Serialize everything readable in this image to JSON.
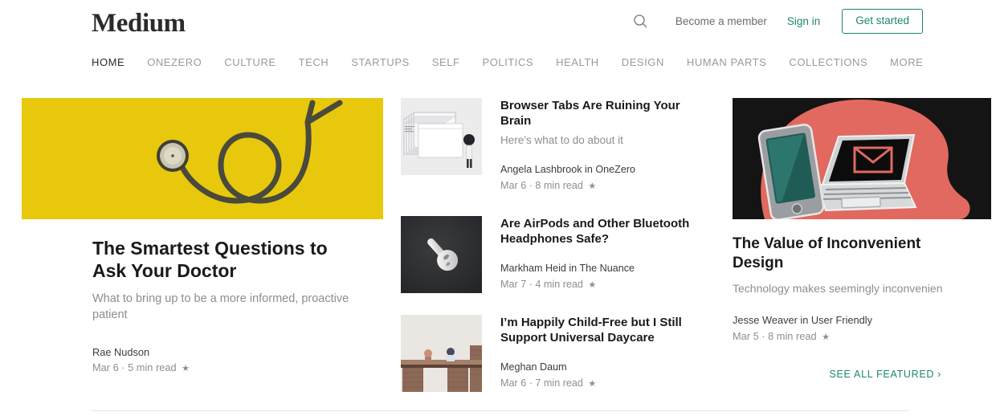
{
  "header": {
    "brand": "Medium",
    "search_icon": "search-icon",
    "become_member": "Become a member",
    "sign_in": "Sign in",
    "get_started": "Get started",
    "accent_color": "#1a8870"
  },
  "nav": {
    "items": [
      {
        "label": "HOME",
        "active": true
      },
      {
        "label": "ONEZERO",
        "active": false
      },
      {
        "label": "CULTURE",
        "active": false
      },
      {
        "label": "TECH",
        "active": false
      },
      {
        "label": "STARTUPS",
        "active": false
      },
      {
        "label": "SELF",
        "active": false
      },
      {
        "label": "POLITICS",
        "active": false
      },
      {
        "label": "HEALTH",
        "active": false
      },
      {
        "label": "DESIGN",
        "active": false
      },
      {
        "label": "HUMAN PARTS",
        "active": false
      },
      {
        "label": "COLLECTIONS",
        "active": false
      },
      {
        "label": "MORE",
        "active": false
      }
    ]
  },
  "hero": {
    "image_alt": "stethoscope-on-yellow-background",
    "image_bg_color": "#e8c80d",
    "title": "The Smartest Questions to Ask Your Doctor",
    "subtitle": "What to bring up to be a more informed, proactive patient",
    "author": "Rae Nudson",
    "date": "Mar 6",
    "read_time": "5 min read",
    "separator": "·",
    "starred": "★"
  },
  "middle": {
    "cards": [
      {
        "thumb_alt": "stacked-browser-windows-illustration",
        "thumb_bg": "#ececed",
        "title": "Browser Tabs Are Ruining Your Brain",
        "subtitle": "Here’s what to do about it",
        "author": "Angela Lashbrook in OneZero",
        "date": "Mar 6",
        "read_time": "8 min read",
        "separator": "·",
        "starred": "★"
      },
      {
        "thumb_alt": "airpod-on-dark-background",
        "thumb_bg": "#2f3133",
        "title": "Are AirPods and Other Bluetooth Headphones Safe?",
        "subtitle": "",
        "author": "Markham Heid in The Nuance",
        "date": "Mar 7",
        "read_time": "4 min read",
        "separator": "·",
        "starred": "★"
      },
      {
        "thumb_alt": "coin-stack-bridge-with-figures",
        "thumb_bg": "#e9e4e0",
        "title": "I’m Happily Child-Free but I Still Support Universal Daycare",
        "subtitle": "",
        "author": "Meghan Daum",
        "date": "Mar 6",
        "read_time": "7 min read",
        "separator": "·",
        "starred": "★"
      }
    ]
  },
  "right": {
    "image_alt": "laptop-phone-envelope-illustration-on-red-head-silhouette",
    "image_bg": "#141414",
    "title": "The Value of Inconvenient Design",
    "subtitle": "Technology makes seemingly inconvenien",
    "author": "Jesse Weaver in User Friendly",
    "date": "Mar 5",
    "read_time": "8 min read",
    "separator": "·",
    "starred": "★",
    "see_all_label": "SEE ALL FEATURED",
    "see_all_chevron": "›"
  }
}
